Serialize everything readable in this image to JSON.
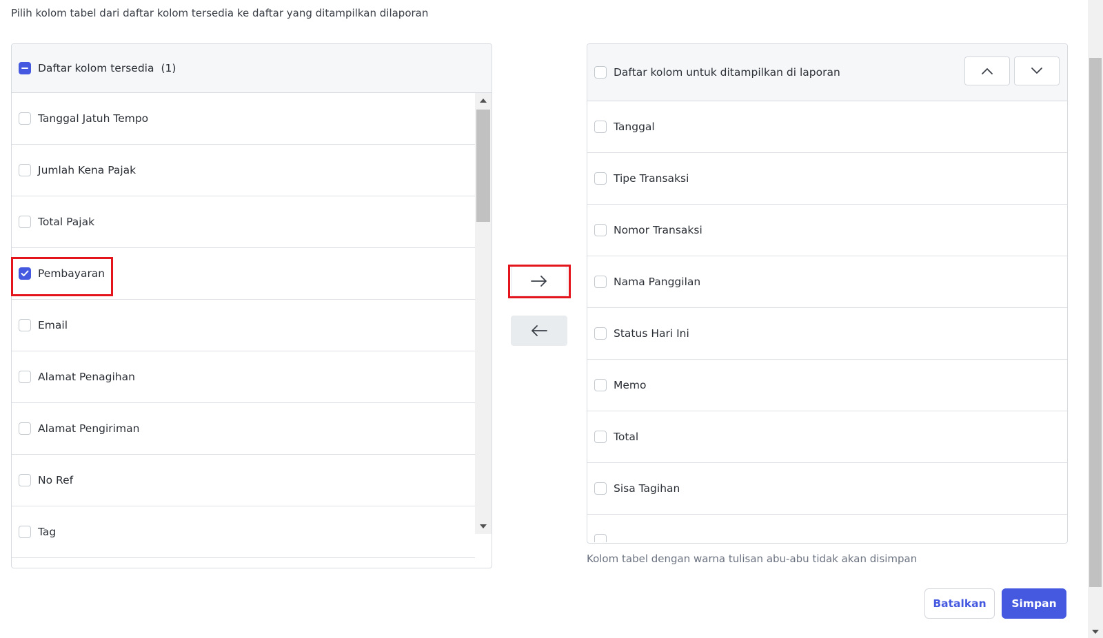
{
  "instruction": "Pilih kolom tabel dari daftar kolom tersedia ke daftar yang ditampilkan dilaporan",
  "available": {
    "header_label": "Daftar kolom tersedia",
    "count": "(1)",
    "items": [
      {
        "label": "Tanggal Jatuh Tempo",
        "checked": false
      },
      {
        "label": "Jumlah Kena Pajak",
        "checked": false
      },
      {
        "label": "Total Pajak",
        "checked": false
      },
      {
        "label": "Pembayaran",
        "checked": true
      },
      {
        "label": "Email",
        "checked": false
      },
      {
        "label": "Alamat Penagihan",
        "checked": false
      },
      {
        "label": "Alamat Pengiriman",
        "checked": false
      },
      {
        "label": "No Ref",
        "checked": false
      },
      {
        "label": "Tag",
        "checked": false
      }
    ]
  },
  "selected": {
    "header_label": "Daftar kolom untuk ditampilkan di laporan",
    "items": [
      {
        "label": "Tanggal",
        "checked": false
      },
      {
        "label": "Tipe Transaksi",
        "checked": false
      },
      {
        "label": "Nomor Transaksi",
        "checked": false
      },
      {
        "label": "Nama Panggilan",
        "checked": false
      },
      {
        "label": "Status Hari Ini",
        "checked": false
      },
      {
        "label": "Memo",
        "checked": false
      },
      {
        "label": "Total",
        "checked": false
      },
      {
        "label": "Sisa Tagihan",
        "checked": false
      },
      {
        "label": "",
        "checked": false
      }
    ]
  },
  "note": "Kolom tabel dengan warna tulisan abu-abu tidak akan disimpan",
  "buttons": {
    "cancel": "Batalkan",
    "save": "Simpan"
  },
  "icons": {
    "move_right": "arrow-right-icon",
    "move_left": "arrow-left-icon",
    "move_up": "chevron-up-icon",
    "move_down": "chevron-down-icon"
  },
  "colors": {
    "accent": "#4458e0",
    "highlight": "#e3141c"
  }
}
